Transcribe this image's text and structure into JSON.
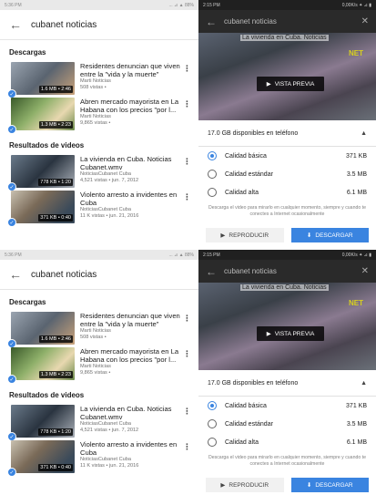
{
  "left": {
    "status_time": "5:36 PM",
    "status_right": "... ⊿ ▲ 88%",
    "search_query": "cubanet noticias",
    "sections": {
      "downloads": "Descargas",
      "results": "Resultados de videos"
    },
    "downloads": [
      {
        "title": "Residentes denuncian que viven entre la \"vida y la muerte\"",
        "channel": "Marti Noticias",
        "stats": "508 vistas •",
        "duration": "1.6 MB • 2:46"
      },
      {
        "title": "Abren mercado mayorista en La Habana con los precios \"por l...",
        "channel": "Marti Noticias",
        "stats": "9,865 vistas •",
        "duration": "1.3 MB • 2:23"
      }
    ],
    "results": [
      {
        "title": "La vivienda en Cuba. Noticias Cubanet.wmv",
        "channel": "NoticiasCubanet Cuba",
        "stats": "4,521 vistas • jun. 7, 2012",
        "duration": "778 KB • 1:20"
      },
      {
        "title": "Violento arresto a invidentes en Cuba",
        "channel": "NoticiasCubanet Cuba",
        "stats": "11 K vistas • jun. 21, 2016",
        "duration": "371 KB • 0:40"
      }
    ]
  },
  "right": {
    "status_time": "2:15 PM",
    "status_right": "0,00K/s ✦ ⊿ ▮",
    "title": "cubanet noticias",
    "video_caption": "La vivienda en Cuba. Noticias",
    "video_logo": "NET",
    "preview_label": "VISTA PREVIA",
    "storage_text": "17.0 GB disponibles en teléfono",
    "options": [
      {
        "label": "Calidad básica",
        "size": "371 KB",
        "selected": true
      },
      {
        "label": "Calidad estándar",
        "size": "3.5 MB",
        "selected": false
      },
      {
        "label": "Calidad alta",
        "size": "6.1 MB",
        "selected": false
      }
    ],
    "note": "Descarga el video para mirarlo en cualquier momento, siempre y cuando te conectes a Internet ocasionalmente",
    "play_label": "REPRODUCIR",
    "download_label": "DESCARGAR"
  },
  "bottom": {
    "left_status_time": "5:36 PM"
  },
  "colors": {
    "accent": "#3a84e0",
    "dark_header": "#202020"
  }
}
